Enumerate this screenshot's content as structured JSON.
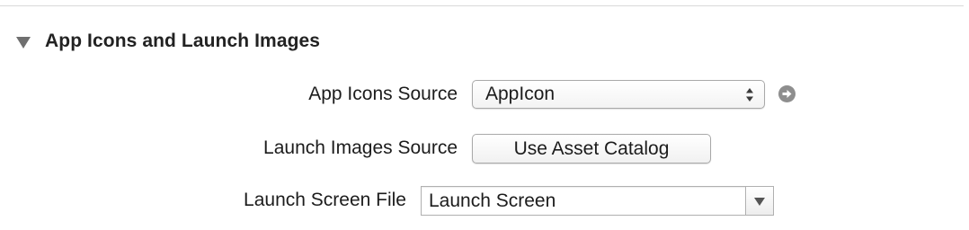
{
  "section": {
    "title": "App Icons and Launch Images",
    "disclosure_icon": "disclosure-triangle-down-icon"
  },
  "app_icons_source": {
    "label": "App Icons Source",
    "selected": "AppIcon",
    "arrows_icon": "popup-arrows-icon",
    "goto_icon": "navigate-arrow-icon"
  },
  "launch_images_source": {
    "label": "Launch Images Source",
    "button_label": "Use Asset Catalog"
  },
  "launch_screen_file": {
    "label": "Launch Screen File",
    "value": "Launch Screen",
    "dropdown_icon": "chevron-down-icon"
  },
  "colors": {
    "divider": "#d9d9d9",
    "disclosure": "#6f6f6f",
    "goto_button": "#8e8e8e",
    "control_border": "#a9a9a9"
  }
}
